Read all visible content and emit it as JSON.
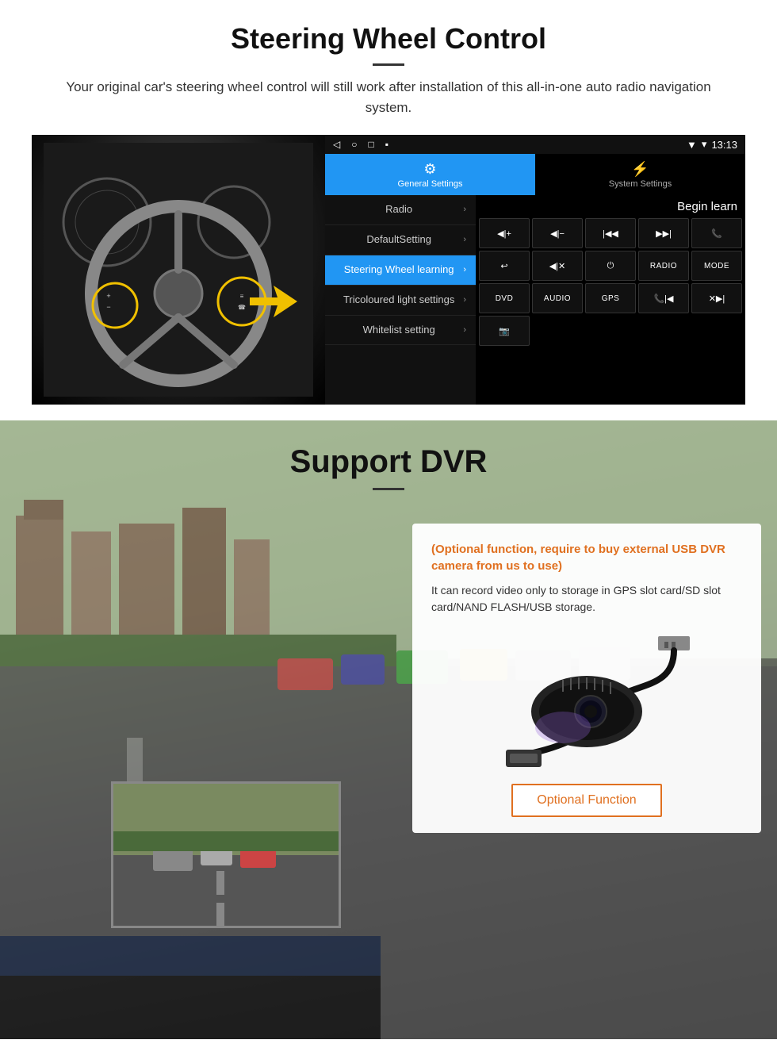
{
  "steering": {
    "title": "Steering Wheel Control",
    "subtitle": "Your original car's steering wheel control will still work after installation of this all-in-one auto radio navigation system.",
    "status_bar": {
      "nav_back": "◁",
      "nav_home": "○",
      "nav_recent": "□",
      "nav_menu": "▪",
      "signal": "▼",
      "wifi": "▾",
      "time": "13:13"
    },
    "tabs": [
      {
        "id": "general",
        "icon": "⚙",
        "label": "General Settings",
        "active": true
      },
      {
        "id": "system",
        "icon": "⚡",
        "label": "System Settings",
        "active": false
      }
    ],
    "menu_items": [
      {
        "id": "radio",
        "label": "Radio",
        "selected": false
      },
      {
        "id": "default",
        "label": "DefaultSetting",
        "selected": false
      },
      {
        "id": "steering",
        "label": "Steering Wheel learning",
        "selected": true
      },
      {
        "id": "tricoloured",
        "label": "Tricoloured light settings",
        "selected": false
      },
      {
        "id": "whitelist",
        "label": "Whitelist setting",
        "selected": false
      }
    ],
    "begin_learn": "Begin learn",
    "control_buttons": [
      {
        "id": "vol_plus",
        "label": "◀|+"
      },
      {
        "id": "vol_minus",
        "label": "◀|−"
      },
      {
        "id": "prev_track",
        "label": "|◀◀"
      },
      {
        "id": "next_track",
        "label": "▶▶|"
      },
      {
        "id": "phone",
        "label": "📞"
      },
      {
        "id": "hang_up",
        "label": "↩"
      },
      {
        "id": "mute",
        "label": "◀|✕"
      },
      {
        "id": "power",
        "label": "⏻"
      },
      {
        "id": "radio_btn",
        "label": "RADIO"
      },
      {
        "id": "mode_btn",
        "label": "MODE"
      },
      {
        "id": "dvd_btn",
        "label": "DVD"
      },
      {
        "id": "audio_btn",
        "label": "AUDIO"
      },
      {
        "id": "gps_btn",
        "label": "GPS"
      },
      {
        "id": "call_prev",
        "label": "📞|◀◀"
      },
      {
        "id": "call_next",
        "label": "✕▶▶|"
      },
      {
        "id": "camera_btn",
        "label": "📷"
      }
    ]
  },
  "dvr": {
    "title": "Support DVR",
    "optional_text": "(Optional function, require to buy external USB DVR camera from us to use)",
    "desc_text": "It can record video only to storage in GPS slot card/SD slot card/NAND FLASH/USB storage.",
    "optional_fn_label": "Optional Function"
  }
}
